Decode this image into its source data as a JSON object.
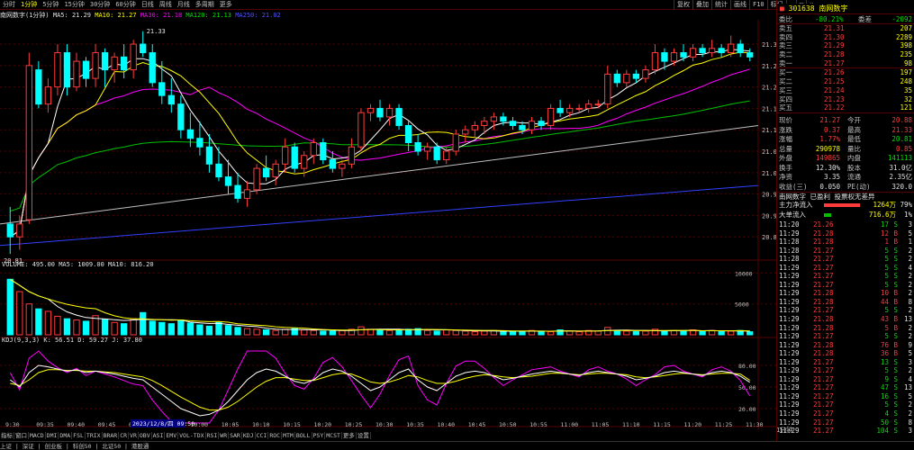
{
  "top_tabs": [
    "分时",
    "1分钟",
    "5分钟",
    "15分钟",
    "30分钟",
    "60分钟",
    "日线",
    "周线",
    "月线",
    "多周期",
    "更多"
  ],
  "top_tabs_active": 1,
  "tool_tabs": [
    "复权",
    "叠加",
    "统计",
    "画线",
    "F10",
    "标记",
    "-",
    "□",
    "×"
  ],
  "info_bar": {
    "title": "南网数字(1分钟)",
    "ma5": "MA5: 21.29",
    "ma10": "MA10: 21.27",
    "ma30": "MA30: 21.18",
    "ma120": "MA120: 21.13",
    "ma250": "MA250: 21.02"
  },
  "price_axis": [
    "21.30",
    "21.25",
    "21.20",
    "21.15",
    "21.10",
    "21.05",
    "21.00",
    "20.95",
    "20.90",
    "20.85"
  ],
  "high_label": "21.33",
  "low_label": "20.81",
  "volume_bar": {
    "title": "VOLUME: 495.00",
    "ma5": "MA5: 1009.00",
    "ma10": "MA10: 816.20"
  },
  "volume_axis": [
    "10000",
    "5000"
  ],
  "kdj_bar": {
    "title": "KDJ(9,3,3)",
    "k": "K: 56.51",
    "d": "D: 59.27",
    "j": "J: 37.80"
  },
  "kdj_axis": [
    "80.00",
    "50.00",
    "20.00"
  ],
  "time_axis": [
    "9:30",
    "09:35",
    "09:40",
    "09:45",
    "09:50",
    "09:55",
    "10:00",
    "10:05",
    "10:10",
    "10:15",
    "10:20",
    "10:25",
    "10:30",
    "10:35",
    "10:40",
    "10:45",
    "10:50",
    "10:55",
    "11:00",
    "11:05",
    "11:10",
    "11:15",
    "11:20",
    "11:25",
    "11:30"
  ],
  "time_axis_first": "1/8(周四)",
  "cursor_label": "2023/12/8/四 09:50",
  "bottom_tabs": [
    "指标",
    "窗口",
    "MACD",
    "DMI",
    "DMA",
    "FSL",
    "TRIX",
    "BRAR",
    "CR",
    "VR",
    "OBV",
    "ASI",
    "EMV",
    "VOL-TDX",
    "RSI",
    "WR",
    "SAR",
    "KDJ",
    "CCI",
    "ROC",
    "MTM",
    "BOLL",
    "PSY",
    "MCST",
    "更多",
    "设置"
  ],
  "status_bar": "上证 | 深证 | 创业板 | 科创50 | 北证50 | 港股通",
  "bottom_right": "1分钟",
  "stock": {
    "code": "301638",
    "name": "南网数字"
  },
  "ratio": {
    "label": "委比",
    "value": "-80.21%",
    "label2": "委差",
    "value2": "-2092"
  },
  "asks": [
    {
      "label": "卖五",
      "price": "21.31",
      "vol": "207"
    },
    {
      "label": "卖四",
      "price": "21.30",
      "vol": "2289"
    },
    {
      "label": "卖三",
      "price": "21.29",
      "vol": "398"
    },
    {
      "label": "卖二",
      "price": "21.28",
      "vol": "235"
    },
    {
      "label": "卖一",
      "price": "21.27",
      "vol": "98"
    }
  ],
  "bids": [
    {
      "label": "买一",
      "price": "21.26",
      "vol": "197"
    },
    {
      "label": "买二",
      "price": "21.25",
      "vol": "248"
    },
    {
      "label": "买三",
      "price": "21.24",
      "vol": "35"
    },
    {
      "label": "买四",
      "price": "21.23",
      "vol": "32"
    },
    {
      "label": "买五",
      "price": "21.22",
      "vol": "121"
    }
  ],
  "stats": [
    {
      "l1": "现价",
      "v1": "21.27",
      "c1": "red",
      "l2": "今开",
      "v2": "20.88",
      "c2": "red"
    },
    {
      "l1": "涨跌",
      "v1": "0.37",
      "c1": "red",
      "l2": "最高",
      "v2": "21.33",
      "c2": "red"
    },
    {
      "l1": "涨幅",
      "v1": "1.77%",
      "c1": "red",
      "l2": "最低",
      "v2": "20.81",
      "c2": "green"
    },
    {
      "l1": "总量",
      "v1": "290978",
      "c1": "yellow",
      "l2": "量比",
      "v2": "0.85",
      "c2": "red"
    },
    {
      "l1": "外盘",
      "v1": "149865",
      "c1": "red",
      "l2": "内盘",
      "v2": "141113",
      "c2": "green"
    },
    {
      "l1": "换手",
      "v1": "12.30%",
      "c1": "white",
      "l2": "股本",
      "v2": "31.0亿",
      "c2": "white"
    },
    {
      "l1": "净资",
      "v1": "3.35",
      "c1": "white",
      "l2": "流通",
      "v2": "2.35亿",
      "c2": "white"
    },
    {
      "l1": "收益(三)",
      "v1": "0.050",
      "c1": "white",
      "l2": "PE(动)",
      "v2": "320.0",
      "c2": "white"
    }
  ],
  "notice": "南网数字 已盈利 投票权无差异",
  "flow": [
    {
      "label": "主力净流入",
      "value": "1264万",
      "pct": "79%",
      "bar": 0.79
    },
    {
      "label": "大单流入",
      "value": "716.6万",
      "pct": "1%",
      "bar": 0.15
    }
  ],
  "ticks": [
    {
      "t": "11:20",
      "p": "21.26",
      "v": "17",
      "d": "S",
      "n": "3"
    },
    {
      "t": "11:29",
      "p": "21.28",
      "v": "12",
      "d": "B",
      "n": "5"
    },
    {
      "t": "11:28",
      "p": "21.28",
      "v": "1",
      "d": "B",
      "n": "1"
    },
    {
      "t": "11:28",
      "p": "21.27",
      "v": "5",
      "d": "S",
      "n": "2"
    },
    {
      "t": "11:28",
      "p": "21.27",
      "v": "5",
      "d": "S",
      "n": "2"
    },
    {
      "t": "11:29",
      "p": "21.27",
      "v": "5",
      "d": "S",
      "n": "4"
    },
    {
      "t": "11:29",
      "p": "21.27",
      "v": "5",
      "d": "S",
      "n": "2"
    },
    {
      "t": "11:29",
      "p": "21.27",
      "v": "5",
      "d": "S",
      "n": "2"
    },
    {
      "t": "11:29",
      "p": "21.28",
      "v": "10",
      "d": "B",
      "n": "2"
    },
    {
      "t": "11:29",
      "p": "21.28",
      "v": "44",
      "d": "B",
      "n": "8"
    },
    {
      "t": "11:29",
      "p": "21.27",
      "v": "5",
      "d": "S",
      "n": "2"
    },
    {
      "t": "11:29",
      "p": "21.28",
      "v": "43",
      "d": "B",
      "n": "13"
    },
    {
      "t": "11:29",
      "p": "21.28",
      "v": "5",
      "d": "B",
      "n": "2"
    },
    {
      "t": "11:29",
      "p": "21.27",
      "v": "5",
      "d": "S",
      "n": "2"
    },
    {
      "t": "11:29",
      "p": "21.28",
      "v": "76",
      "d": "B",
      "n": "9"
    },
    {
      "t": "11:29",
      "p": "21.28",
      "v": "36",
      "d": "B",
      "n": "5"
    },
    {
      "t": "11:29",
      "p": "21.27",
      "v": "13",
      "d": "S",
      "n": "3"
    },
    {
      "t": "11:29",
      "p": "21.27",
      "v": "5",
      "d": "S",
      "n": "2"
    },
    {
      "t": "11:29",
      "p": "21.27",
      "v": "9",
      "d": "S",
      "n": "4"
    },
    {
      "t": "11:29",
      "p": "21.27",
      "v": "47",
      "d": "S",
      "n": "13"
    },
    {
      "t": "11:29",
      "p": "21.27",
      "v": "16",
      "d": "S",
      "n": "5"
    },
    {
      "t": "11:29",
      "p": "21.27",
      "v": "5",
      "d": "S",
      "n": "2"
    },
    {
      "t": "11:29",
      "p": "21.27",
      "v": "4",
      "d": "S",
      "n": "2"
    },
    {
      "t": "11:29",
      "p": "21.27",
      "v": "50",
      "d": "S",
      "n": "8"
    },
    {
      "t": "11:29",
      "p": "21.27",
      "v": "104",
      "d": "S",
      "n": "3"
    }
  ],
  "colors": {
    "up": "#ff3c3c",
    "down": "#00ffff",
    "ma5": "#ffffff",
    "ma10": "#ffff00",
    "ma30": "#ff00ff",
    "ma120": "#00c000",
    "ma250": "#c0c0c0",
    "ma_long": "#3040ff",
    "grid": "#550000"
  },
  "chart_data": {
    "type": "candlestick",
    "title": "南网数字(1分钟)",
    "ylim": [
      20.8,
      21.34
    ],
    "candles": [
      [
        20.88,
        20.92,
        20.81,
        20.85
      ],
      [
        20.85,
        20.9,
        20.82,
        20.88
      ],
      [
        20.89,
        21.28,
        20.88,
        21.25
      ],
      [
        21.24,
        21.26,
        21.15,
        21.16
      ],
      [
        21.16,
        21.22,
        21.14,
        21.2
      ],
      [
        21.2,
        21.3,
        21.18,
        21.28
      ],
      [
        21.28,
        21.3,
        21.18,
        21.2
      ],
      [
        21.2,
        21.28,
        21.19,
        21.26
      ],
      [
        21.26,
        21.27,
        21.2,
        21.22
      ],
      [
        21.22,
        21.3,
        21.2,
        21.28
      ],
      [
        21.28,
        21.29,
        21.2,
        21.24
      ],
      [
        21.24,
        21.28,
        21.21,
        21.27
      ],
      [
        21.27,
        21.3,
        21.22,
        21.24
      ],
      [
        21.24,
        21.31,
        21.22,
        21.3
      ],
      [
        21.3,
        21.33,
        21.27,
        21.28
      ],
      [
        21.28,
        21.3,
        21.2,
        21.21
      ],
      [
        21.21,
        21.26,
        21.16,
        21.18
      ],
      [
        21.18,
        21.22,
        21.14,
        21.16
      ],
      [
        21.16,
        21.18,
        21.08,
        21.1
      ],
      [
        21.1,
        21.14,
        21.06,
        21.08
      ],
      [
        21.08,
        21.12,
        21.04,
        21.06
      ],
      [
        21.06,
        21.09,
        21.0,
        21.02
      ],
      [
        21.02,
        21.06,
        20.98,
        20.99
      ],
      [
        20.99,
        21.03,
        20.95,
        20.97
      ],
      [
        20.97,
        21.0,
        20.93,
        20.94
      ],
      [
        20.94,
        20.98,
        20.92,
        20.96
      ],
      [
        20.96,
        21.02,
        20.95,
        21.01
      ],
      [
        21.01,
        21.04,
        20.98,
        20.99
      ],
      [
        20.99,
        21.03,
        20.97,
        21.02
      ],
      [
        21.02,
        21.08,
        21.0,
        21.06
      ],
      [
        21.06,
        21.07,
        21.0,
        21.01
      ],
      [
        21.01,
        21.05,
        20.99,
        21.04
      ],
      [
        21.04,
        21.08,
        21.02,
        21.07
      ],
      [
        21.07,
        21.08,
        21.02,
        21.03
      ],
      [
        21.03,
        21.05,
        21.0,
        21.01
      ],
      [
        21.01,
        21.03,
        20.99,
        21.02
      ],
      [
        21.02,
        21.08,
        21.01,
        21.06
      ],
      [
        21.06,
        21.15,
        21.05,
        21.14
      ],
      [
        21.14,
        21.16,
        21.12,
        21.15
      ],
      [
        21.15,
        21.17,
        21.12,
        21.13
      ],
      [
        21.13,
        21.16,
        21.11,
        21.15
      ],
      [
        21.15,
        21.16,
        21.1,
        21.11
      ],
      [
        21.11,
        21.12,
        21.05,
        21.07
      ],
      [
        21.07,
        21.09,
        21.04,
        21.05
      ],
      [
        21.05,
        21.07,
        21.03,
        21.06
      ],
      [
        21.06,
        21.07,
        21.02,
        21.03
      ],
      [
        21.03,
        21.06,
        21.02,
        21.05
      ],
      [
        21.05,
        21.1,
        21.04,
        21.09
      ],
      [
        21.09,
        21.11,
        21.07,
        21.1
      ],
      [
        21.1,
        21.12,
        21.08,
        21.11
      ],
      [
        21.11,
        21.13,
        21.09,
        21.12
      ],
      [
        21.12,
        21.14,
        21.1,
        21.13
      ],
      [
        21.13,
        21.14,
        21.11,
        21.12
      ],
      [
        21.12,
        21.13,
        21.1,
        21.11
      ],
      [
        21.11,
        21.12,
        21.09,
        21.1
      ],
      [
        21.1,
        21.13,
        21.09,
        21.12
      ],
      [
        21.12,
        21.13,
        21.1,
        21.11
      ],
      [
        21.11,
        21.16,
        21.1,
        21.15
      ],
      [
        21.15,
        21.17,
        21.13,
        21.14
      ],
      [
        21.14,
        21.16,
        21.13,
        21.15
      ],
      [
        21.15,
        21.16,
        21.14,
        21.15
      ],
      [
        21.15,
        21.17,
        21.14,
        21.16
      ],
      [
        21.16,
        21.17,
        21.15,
        21.16
      ],
      [
        21.16,
        21.25,
        21.15,
        21.23
      ],
      [
        21.23,
        21.24,
        21.2,
        21.21
      ],
      [
        21.21,
        21.24,
        21.2,
        21.23
      ],
      [
        21.23,
        21.24,
        21.21,
        21.22
      ],
      [
        21.22,
        21.25,
        21.21,
        21.24
      ],
      [
        21.24,
        21.3,
        21.23,
        21.28
      ],
      [
        21.28,
        21.29,
        21.24,
        21.26
      ],
      [
        21.26,
        21.29,
        21.25,
        21.28
      ],
      [
        21.28,
        21.3,
        21.26,
        21.27
      ],
      [
        21.27,
        21.3,
        21.26,
        21.29
      ],
      [
        21.29,
        21.3,
        21.27,
        21.28
      ],
      [
        21.28,
        21.31,
        21.27,
        21.29
      ],
      [
        21.29,
        21.3,
        21.27,
        21.28
      ],
      [
        21.28,
        21.32,
        21.27,
        21.3
      ],
      [
        21.3,
        21.31,
        21.27,
        21.28
      ],
      [
        21.28,
        21.29,
        21.26,
        21.27
      ]
    ],
    "volume": [
      9000,
      7000,
      5000,
      4200,
      3800,
      3000,
      2600,
      2400,
      2200,
      3100,
      2500,
      2000,
      1800,
      2600,
      3600,
      2200,
      2000,
      1800,
      2400,
      1900,
      1600,
      1400,
      2000,
      1500,
      1200,
      1000,
      900,
      800,
      700,
      900,
      1000,
      800,
      700,
      600,
      600,
      700,
      900,
      1300,
      900,
      800,
      700,
      800,
      900,
      1000,
      700,
      600,
      800,
      700,
      600,
      500,
      600,
      700,
      500,
      600,
      500,
      700,
      600,
      500,
      800,
      600,
      500,
      700,
      600,
      1200,
      700,
      600,
      500,
      600,
      900,
      600,
      700,
      600,
      800,
      600,
      700,
      500,
      600,
      700,
      495
    ],
    "kdj": {
      "k": [
        60,
        50,
        70,
        80,
        78,
        75,
        72,
        74,
        70,
        72,
        70,
        68,
        65,
        62,
        60,
        50,
        40,
        30,
        20,
        15,
        10,
        12,
        18,
        30,
        45,
        60,
        70,
        75,
        72,
        65,
        58,
        55,
        60,
        70,
        75,
        72,
        65,
        55,
        45,
        50,
        60,
        70,
        75,
        60,
        50,
        45,
        55,
        65,
        70,
        72,
        70,
        65,
        60,
        62,
        65,
        68,
        70,
        72,
        70,
        68,
        66,
        70,
        72,
        70,
        68,
        65,
        60,
        62,
        65,
        70,
        72,
        70,
        68,
        66,
        70,
        72,
        70,
        65,
        56.51
      ],
      "d": [
        55,
        52,
        60,
        70,
        74,
        74,
        73,
        73,
        72,
        72,
        71,
        70,
        68,
        66,
        64,
        59,
        52,
        44,
        36,
        29,
        22,
        18,
        18,
        22,
        30,
        40,
        50,
        58,
        63,
        63,
        61,
        59,
        59,
        63,
        67,
        69,
        68,
        63,
        57,
        55,
        57,
        61,
        66,
        64,
        59,
        55,
        55,
        58,
        62,
        65,
        67,
        66,
        64,
        63,
        64,
        65,
        67,
        69,
        69,
        68,
        67,
        68,
        69,
        69,
        68,
        67,
        64,
        63,
        64,
        66,
        68,
        69,
        68,
        67,
        68,
        69,
        69,
        68,
        59.27
      ],
      "j": [
        70,
        46,
        90,
        100,
        86,
        77,
        70,
        76,
        66,
        72,
        68,
        64,
        59,
        54,
        52,
        32,
        16,
        2,
        0,
        0,
        0,
        0,
        18,
        46,
        75,
        100,
        100,
        100,
        90,
        69,
        52,
        47,
        62,
        84,
        91,
        78,
        59,
        39,
        21,
        40,
        66,
        88,
        93,
        52,
        32,
        25,
        55,
        79,
        86,
        86,
        76,
        63,
        52,
        60,
        67,
        74,
        76,
        78,
        72,
        68,
        64,
        74,
        78,
        72,
        68,
        61,
        52,
        60,
        67,
        78,
        80,
        72,
        68,
        64,
        74,
        78,
        72,
        59,
        37.8
      ]
    }
  }
}
